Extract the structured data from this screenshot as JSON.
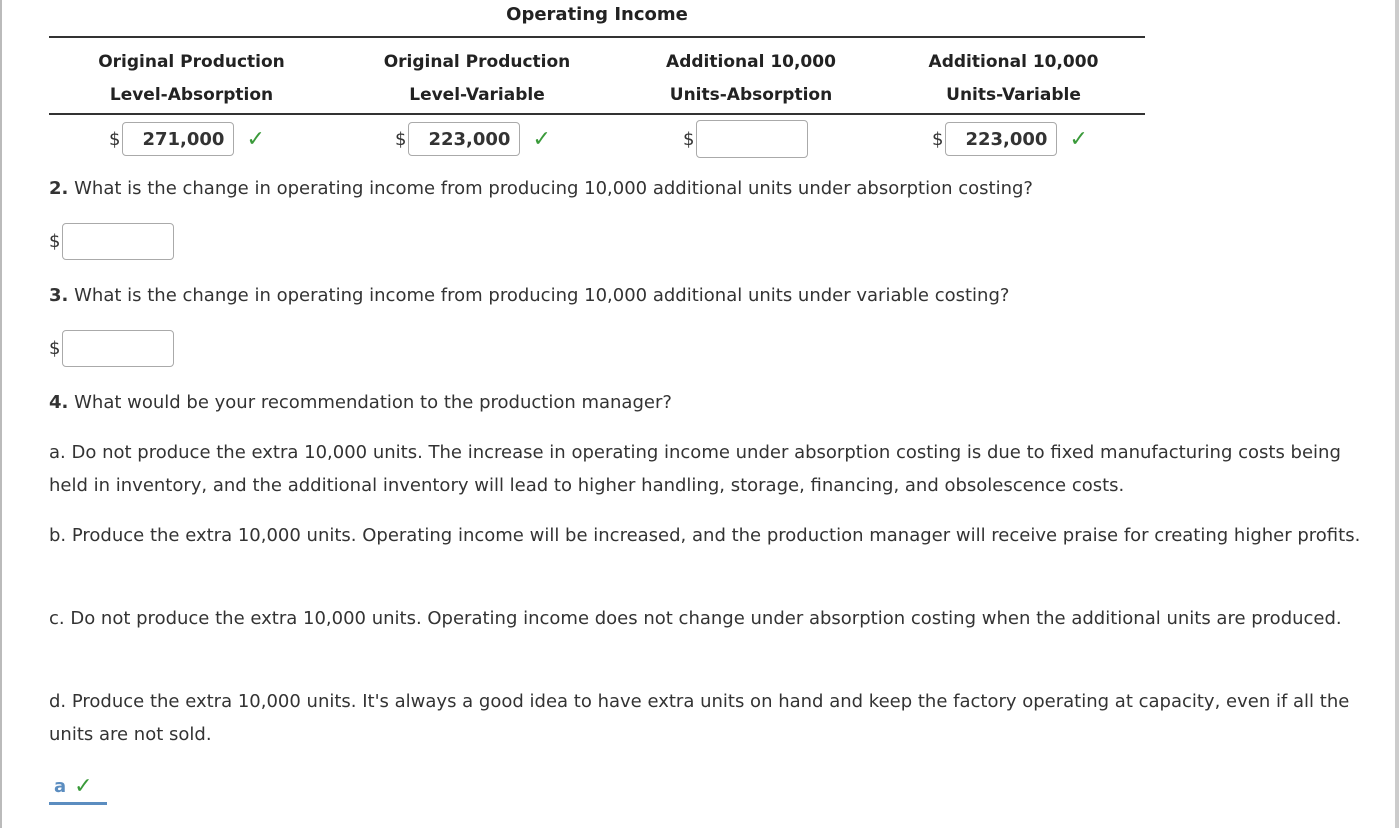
{
  "table": {
    "title": "Operating Income",
    "columns": [
      {
        "line1": "Original Production",
        "line2": "Level-Absorption",
        "currency": "$",
        "value": "271,000",
        "status": "correct"
      },
      {
        "line1": "Original Production",
        "line2": "Level-Variable",
        "currency": "$",
        "value": "223,000",
        "status": "correct"
      },
      {
        "line1": "Additional 10,000",
        "line2": "Units-Absorption",
        "currency": "$",
        "value": "",
        "status": "none"
      },
      {
        "line1": "Additional 10,000",
        "line2": "Units-Variable",
        "currency": "$",
        "value": "223,000",
        "status": "correct"
      }
    ],
    "check_glyph": "✓"
  },
  "questions": [
    {
      "number": "2.",
      "text": "What is the change in operating income from producing 10,000 additional units under absorption costing?",
      "currency": "$",
      "value": ""
    },
    {
      "number": "3.",
      "text": "What is the change in operating income from producing 10,000 additional units under variable costing?",
      "currency": "$",
      "value": ""
    },
    {
      "number": "4.",
      "text": "What would be your recommendation to the production manager?"
    }
  ],
  "options": [
    {
      "text": "a. Do not produce the extra 10,000 units. The increase in operating income under absorption costing is due to fixed manufacturing costs being held in inventory, and the additional inventory will lead to higher handling, storage, financing, and obsolescence costs."
    },
    {
      "text": "b. Produce the extra 10,000 units. Operating income will be increased, and the production manager will receive praise for creating higher profits."
    },
    {
      "text": "c. Do not produce the extra 10,000 units. Operating income does not change under absorption costing when the additional units are produced."
    },
    {
      "text": "d. Produce the extra 10,000 units. It's always a good idea to have extra units on hand and keep the factory operating at capacity, even if all the units are not sold."
    }
  ],
  "selected_answer": {
    "letter": "a",
    "status_glyph": "✓"
  },
  "colors": {
    "correct": "#3a9a3a",
    "answer_accent": "#5b8dc0"
  }
}
